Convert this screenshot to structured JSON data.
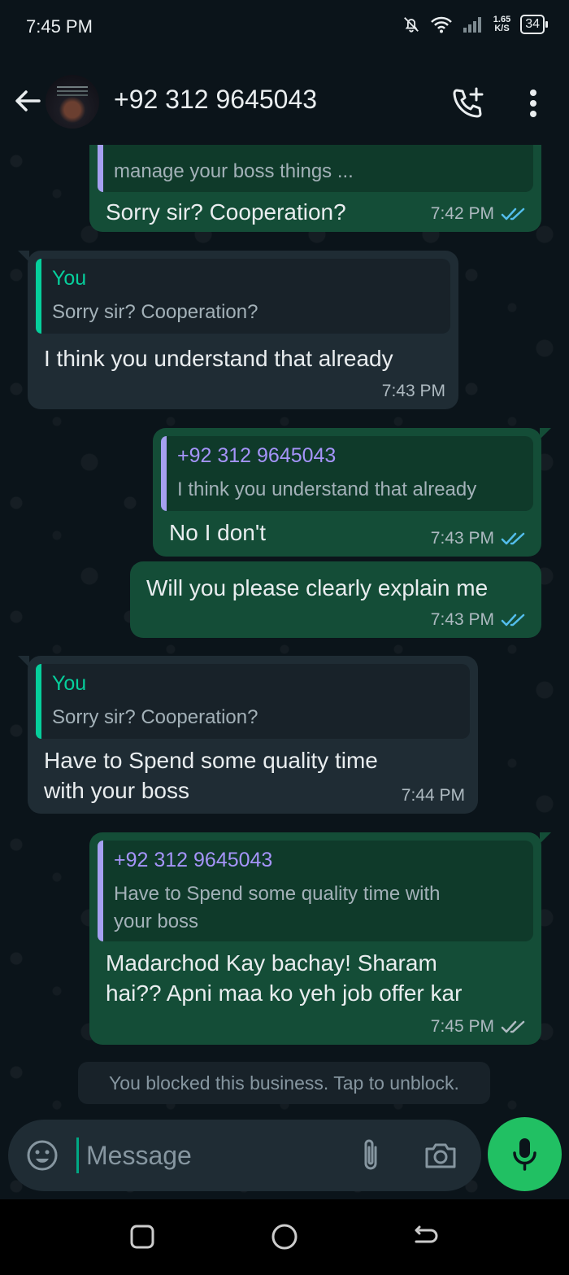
{
  "status_bar": {
    "time": "7:45 PM",
    "net_speed_value": "1.65",
    "net_speed_unit": "K/S",
    "battery": "34",
    "icons": [
      "dnd-bell-off-icon",
      "wifi-icon",
      "signal-icon",
      "battery-icon"
    ]
  },
  "header": {
    "contact": "+92 312 9645043",
    "icons": [
      "back-arrow-icon",
      "avatar",
      "add-call-icon",
      "more-vert-icon"
    ]
  },
  "messages": [
    {
      "direction": "outgoing",
      "quote_text": "manage your boss things ...",
      "text": "Sorry sir? Cooperation?",
      "time": "7:42 PM",
      "ticks": "read"
    },
    {
      "direction": "incoming",
      "quote_author": "You",
      "quote_text": "Sorry sir? Cooperation?",
      "text": "I think you understand  that  already",
      "time": "7:43 PM"
    },
    {
      "direction": "outgoing",
      "quote_author": "+92 312 9645043",
      "quote_text": "I think you understand  that  already",
      "text": "No I don't",
      "time": "7:43 PM",
      "ticks": "read"
    },
    {
      "direction": "outgoing",
      "text": "Will you please clearly explain me",
      "time": "7:43 PM",
      "ticks": "read"
    },
    {
      "direction": "incoming",
      "quote_author": "You",
      "quote_text": "Sorry sir? Cooperation?",
      "text_line1": "Have to Spend some quality  time",
      "text_line2": "with your boss",
      "time": "7:44 PM"
    },
    {
      "direction": "outgoing",
      "quote_author": "+92 312 9645043",
      "quote_text_line1": "Have to Spend some quality  time with",
      "quote_text_line2": "your boss",
      "text_line1": "Madarchod Kay bachay! Sharam",
      "text_line2": "hai?? Apni maa ko yeh job offer kar",
      "time": "7:45 PM",
      "ticks": "delivered"
    }
  ],
  "system_notice": "You blocked this business. Tap to unblock.",
  "input": {
    "placeholder": "Message",
    "value": ""
  },
  "colors": {
    "background": "#0b141a",
    "outgoing_bubble": "#144d37",
    "incoming_bubble": "#1f2c34",
    "accent_green": "#21c063",
    "read_tick_blue": "#53bdeb",
    "quote_bar_you": "#06cf9c",
    "quote_bar_contact": "#a5a0f0",
    "quote_author_contact": "#a594f9"
  },
  "nav_icons": [
    "recents-square-icon",
    "home-circle-icon",
    "back-nav-icon"
  ]
}
